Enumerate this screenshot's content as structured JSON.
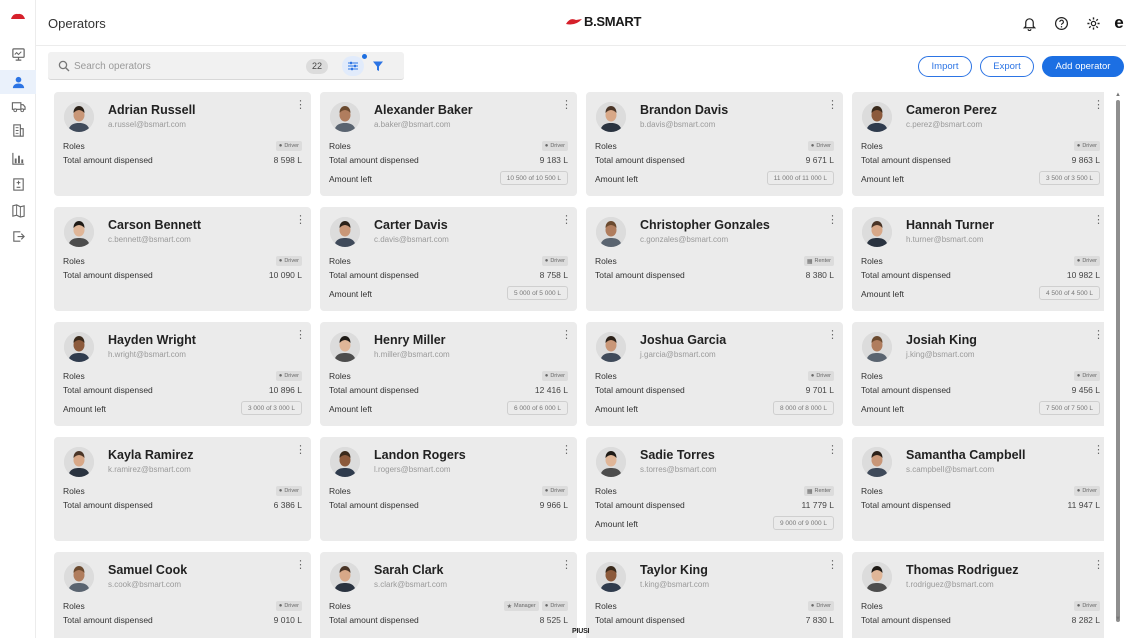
{
  "header": {
    "title": "Operators",
    "brand": "B.SMART"
  },
  "top_icons": [
    "bell-icon",
    "help-icon",
    "settings-icon"
  ],
  "top_letter": "e",
  "sidebar": {
    "items": [
      {
        "name": "dashboard-icon"
      },
      {
        "name": "operators-icon",
        "active": true
      },
      {
        "name": "vehicles-icon"
      },
      {
        "name": "buildings-icon"
      },
      {
        "name": "reports-icon"
      },
      {
        "name": "devices-icon"
      },
      {
        "name": "map-icon"
      },
      {
        "name": "export-icon"
      }
    ]
  },
  "toolbar": {
    "search_placeholder": "Search operators",
    "count": "22",
    "import_label": "Import",
    "export_label": "Export",
    "add_label": "Add operator"
  },
  "labels": {
    "roles": "Roles",
    "total": "Total amount dispensed",
    "amount_left": "Amount left"
  },
  "operators": [
    {
      "name": "Adrian Russell",
      "email": "a.russel@bsmart.com",
      "roles": [
        "Driver"
      ],
      "dispensed": "8 598 L",
      "amount_left": null
    },
    {
      "name": "Alexander Baker",
      "email": "a.baker@bsmart.com",
      "roles": [
        "Driver"
      ],
      "dispensed": "9 183 L",
      "amount_left": "10 500 of 10 500 L"
    },
    {
      "name": "Brandon Davis",
      "email": "b.davis@bsmart.com",
      "roles": [
        "Driver"
      ],
      "dispensed": "9 671 L",
      "amount_left": "11 000 of 11 000 L"
    },
    {
      "name": "Cameron Perez",
      "email": "c.perez@bsmart.com",
      "roles": [
        "Driver"
      ],
      "dispensed": "9 863 L",
      "amount_left": "3 500 of 3 500 L"
    },
    {
      "name": "Carson Bennett",
      "email": "c.bennett@bsmart.com",
      "roles": [
        "Driver"
      ],
      "dispensed": "10 090 L",
      "amount_left": null
    },
    {
      "name": "Carter Davis",
      "email": "c.davis@bsmart.com",
      "roles": [
        "Driver"
      ],
      "dispensed": "8 758 L",
      "amount_left": "5 000 of 5 000 L"
    },
    {
      "name": "Christopher Gonzales",
      "email": "c.gonzales@bsmart.com",
      "roles": [
        "Renter"
      ],
      "dispensed": "8 380 L",
      "amount_left": null
    },
    {
      "name": "Hannah Turner",
      "email": "h.turner@bsmart.com",
      "roles": [
        "Driver"
      ],
      "dispensed": "10 982 L",
      "amount_left": "4 500 of 4 500 L"
    },
    {
      "name": "Hayden Wright",
      "email": "h.wright@bsmart.com",
      "roles": [
        "Driver"
      ],
      "dispensed": "10 896 L",
      "amount_left": "3 000 of 3 000 L"
    },
    {
      "name": "Henry Miller",
      "email": "h.miller@bsmart.com",
      "roles": [
        "Driver"
      ],
      "dispensed": "12 416 L",
      "amount_left": "6 000 of 6 000 L"
    },
    {
      "name": "Joshua Garcia",
      "email": "j.garcia@bsmart.com",
      "roles": [
        "Driver"
      ],
      "dispensed": "9 701 L",
      "amount_left": "8 000 of 8 000 L"
    },
    {
      "name": "Josiah King",
      "email": "j.king@bsmart.com",
      "roles": [
        "Driver"
      ],
      "dispensed": "9 456 L",
      "amount_left": "7 500 of 7 500 L"
    },
    {
      "name": "Kayla Ramirez",
      "email": "k.ramirez@bsmart.com",
      "roles": [
        "Driver"
      ],
      "dispensed": "6 386 L",
      "amount_left": null
    },
    {
      "name": "Landon Rogers",
      "email": "l.rogers@bsmart.com",
      "roles": [
        "Driver"
      ],
      "dispensed": "9 966 L",
      "amount_left": null
    },
    {
      "name": "Sadie Torres",
      "email": "s.torres@bsmart.com",
      "roles": [
        "Renter"
      ],
      "dispensed": "11 779 L",
      "amount_left": "9 000 of 9 000 L"
    },
    {
      "name": "Samantha Campbell",
      "email": "s.campbell@bsmart.com",
      "roles": [
        "Driver"
      ],
      "dispensed": "11 947 L",
      "amount_left": null
    },
    {
      "name": "Samuel Cook",
      "email": "s.cook@bsmart.com",
      "roles": [
        "Driver"
      ],
      "dispensed": "9 010 L",
      "amount_left": null
    },
    {
      "name": "Sarah Clark",
      "email": "s.clark@bsmart.com",
      "roles": [
        "Manager",
        "Driver"
      ],
      "dispensed": "8 525 L",
      "amount_left": null
    },
    {
      "name": "Taylor King",
      "email": "t.king@bsmart.com",
      "roles": [
        "Driver"
      ],
      "dispensed": "7 830 L",
      "amount_left": null
    },
    {
      "name": "Thomas Rodriguez",
      "email": "t.rodriguez@bsmart.com",
      "roles": [
        "Driver"
      ],
      "dispensed": "8 282 L",
      "amount_left": null
    }
  ],
  "footer": {
    "logo": "PIUSI"
  },
  "colors": {
    "accent": "#1c6fe3",
    "brand_red": "#d6202b",
    "card_bg": "#ebebeb"
  }
}
